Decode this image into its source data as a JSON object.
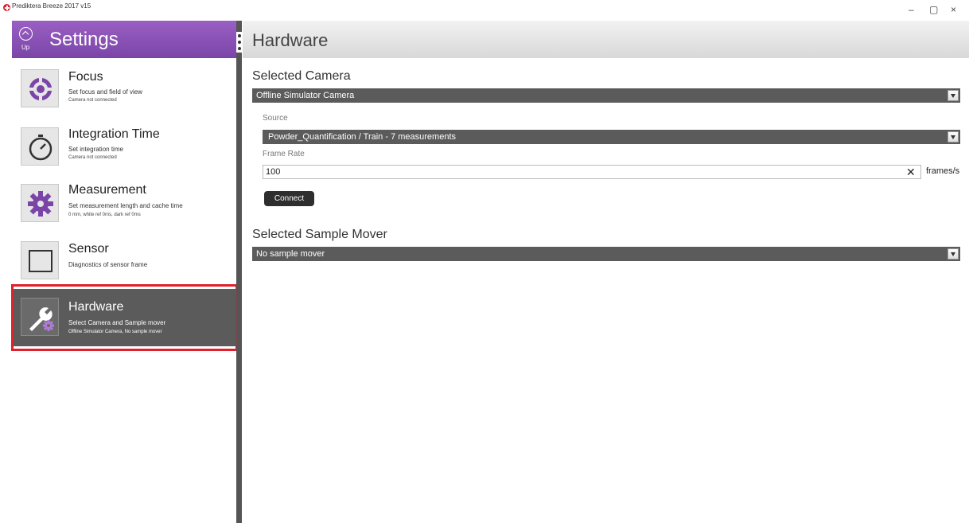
{
  "window": {
    "title": "Prediktera Breeze 2017 v15",
    "controls": {
      "minimize": "–",
      "maximize": "▢",
      "close": "×"
    }
  },
  "sidebar": {
    "up_label": "Up",
    "title": "Settings",
    "items": [
      {
        "label": "Focus",
        "description": "Set focus and field of view",
        "status": "Camera not connected",
        "icon": "focus-target-icon"
      },
      {
        "label": "Integration Time",
        "description": "Set integration time",
        "status": "Camera not connected",
        "icon": "stopwatch-icon"
      },
      {
        "label": "Measurement",
        "description": "Set measurement length and cache time",
        "status": "0 mm, white ref 0ms, dark ref 0ms",
        "icon": "gear-icon"
      },
      {
        "label": "Sensor",
        "description": "Diagnostics of sensor frame",
        "status": "",
        "icon": "sensor-frame-icon"
      },
      {
        "label": "Hardware",
        "description": "Select Camera and Sample mover",
        "status": "Offline Simulator Camera, No sample mover",
        "icon": "wrench-gear-icon",
        "selected": true
      }
    ]
  },
  "content": {
    "title": "Hardware",
    "selected_camera": {
      "heading": "Selected Camera",
      "value": "Offline Simulator Camera"
    },
    "source": {
      "label": "Source",
      "value": "Powder_Quantification / Train - 7 measurements"
    },
    "frame_rate": {
      "label": "Frame Rate",
      "value": "100",
      "unit": "frames/s"
    },
    "connect_label": "Connect",
    "selected_sample_mover": {
      "heading": "Selected Sample Mover",
      "value": "No sample mover"
    }
  },
  "colors": {
    "accent_purple": "#8a52b8",
    "selected_item": "#5b5b5b",
    "highlight_red": "#e0202a",
    "dropdown_bg": "#5b5b5b"
  }
}
